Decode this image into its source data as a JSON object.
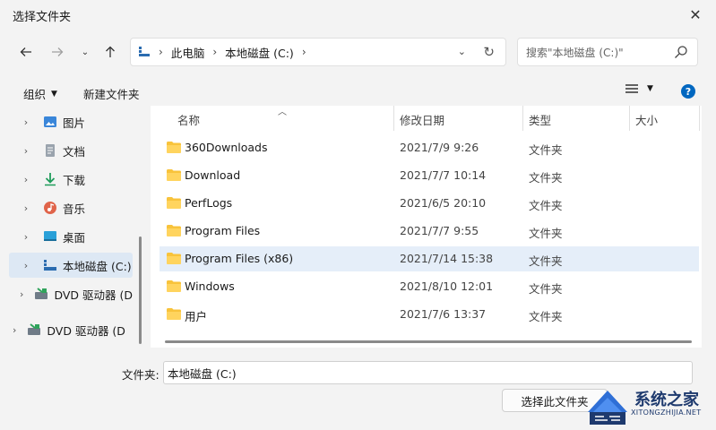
{
  "window": {
    "title": "选择文件夹"
  },
  "address": {
    "segments": [
      "此电脑",
      "本地磁盘 (C:)"
    ]
  },
  "search": {
    "placeholder": "搜索\"本地磁盘 (C:)\""
  },
  "cmdbar": {
    "organize": "组织",
    "new_folder": "新建文件夹"
  },
  "sidebar": {
    "items": [
      {
        "label": "图片",
        "icon": "pictures-icon"
      },
      {
        "label": "文档",
        "icon": "documents-icon"
      },
      {
        "label": "下载",
        "icon": "downloads-icon"
      },
      {
        "label": "音乐",
        "icon": "music-icon"
      },
      {
        "label": "桌面",
        "icon": "desktop-icon"
      },
      {
        "label": "本地磁盘 (C:)",
        "icon": "drive-icon"
      },
      {
        "label": "DVD 驱动器 (D",
        "icon": "dvd-icon"
      },
      {
        "label": "DVD 驱动器 (D:)",
        "icon": "dvd-icon"
      }
    ]
  },
  "columns": {
    "name": "名称",
    "date": "修改日期",
    "type": "类型",
    "size": "大小"
  },
  "files": [
    {
      "name": "360Downloads",
      "date": "2021/7/9 9:26",
      "type": "文件夹"
    },
    {
      "name": "Download",
      "date": "2021/7/7 10:14",
      "type": "文件夹"
    },
    {
      "name": "PerfLogs",
      "date": "2021/6/5 20:10",
      "type": "文件夹"
    },
    {
      "name": "Program Files",
      "date": "2021/7/7 9:55",
      "type": "文件夹"
    },
    {
      "name": "Program Files (x86)",
      "date": "2021/7/14 15:38",
      "type": "文件夹"
    },
    {
      "name": "Windows",
      "date": "2021/8/10 12:01",
      "type": "文件夹"
    },
    {
      "name": "用户",
      "date": "2021/7/6 13:37",
      "type": "文件夹"
    }
  ],
  "footer": {
    "folder_label": "文件夹:",
    "folder_value": "本地磁盘 (C:)",
    "select_button": "选择此文件夹"
  },
  "watermark": {
    "title": "系统之家",
    "subtitle": "XITONGZHIJIA.NET"
  },
  "colors": {
    "accent": "#0067c0",
    "folder": "#f8c33b",
    "selection": "#e5eef9"
  }
}
